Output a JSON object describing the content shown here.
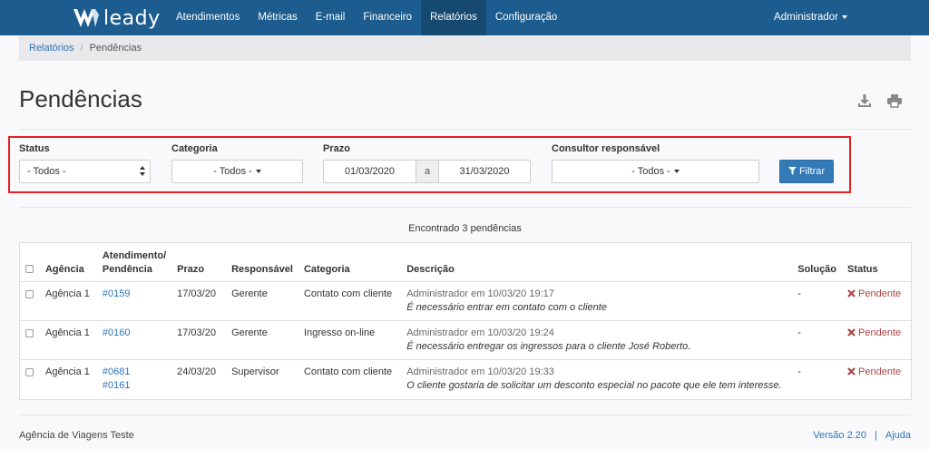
{
  "navbar": {
    "brand": "leady",
    "items": [
      {
        "label": "Atendimentos",
        "active": false
      },
      {
        "label": "Métricas",
        "active": false
      },
      {
        "label": "E-mail",
        "active": false
      },
      {
        "label": "Financeiro",
        "active": false
      },
      {
        "label": "Relatórios",
        "active": true
      },
      {
        "label": "Configuração",
        "active": false
      }
    ],
    "user": "Administrador"
  },
  "breadcrumb": {
    "parent": "Relatórios",
    "current": "Pendências"
  },
  "page": {
    "title": "Pendências"
  },
  "filters": {
    "status": {
      "label": "Status",
      "value": "- Todos -"
    },
    "categoria": {
      "label": "Categoria",
      "value": "- Todos -"
    },
    "prazo": {
      "label": "Prazo",
      "from": "01/03/2020",
      "separator": "a",
      "to": "31/03/2020"
    },
    "consultor": {
      "label": "Consultor responsável",
      "value": "- Todos -"
    },
    "button": "Filtrar"
  },
  "result_summary": "Encontrado 3 pendências",
  "table": {
    "headers": {
      "agencia": "Agência",
      "atendimento_l1": "Atendimento/",
      "atendimento_l2": "Pendência",
      "prazo": "Prazo",
      "responsavel": "Responsável",
      "categoria": "Categoria",
      "descricao": "Descrição",
      "solucao": "Solução",
      "status": "Status"
    },
    "rows": [
      {
        "agencia": "Agência 1",
        "links": [
          "#0159"
        ],
        "prazo": "17/03/20",
        "responsavel": "Gerente",
        "categoria": "Contato com cliente",
        "meta": "Administrador em 10/03/20 19:17",
        "descricao": "É necessário entrar em contato com o cliente",
        "solucao": "-",
        "status": "Pendente"
      },
      {
        "agencia": "Agência 1",
        "links": [
          "#0160"
        ],
        "prazo": "17/03/20",
        "responsavel": "Gerente",
        "categoria": "Ingresso on-line",
        "meta": "Administrador em 10/03/20 19:24",
        "descricao": "É necessário entregar os ingressos para o cliente José Roberto.",
        "solucao": "-",
        "status": "Pendente"
      },
      {
        "agencia": "Agência 1",
        "links": [
          "#0681",
          "#0161"
        ],
        "prazo": "24/03/20",
        "responsavel": "Supervisor",
        "categoria": "Contato com cliente",
        "meta": "Administrador em 10/03/20 19:33",
        "descricao": "O cliente gostaria de solicitar um desconto especial no pacote que ele tem interesse.",
        "solucao": "-",
        "status": "Pendente"
      }
    ]
  },
  "footer": {
    "company": "Agência de Viagens Teste",
    "version": "Versão 2.20",
    "help": "Ajuda"
  },
  "colors": {
    "navbar": "#1c5c8e",
    "nav_active": "#15496f",
    "link": "#2b74b8",
    "primary_button": "#337ab7",
    "pending": "#a94442",
    "highlight_border": "#e02424"
  },
  "icons": [
    "logo-icon",
    "download-icon",
    "print-icon",
    "filter-icon",
    "x-icon",
    "caret-down-icon"
  ]
}
